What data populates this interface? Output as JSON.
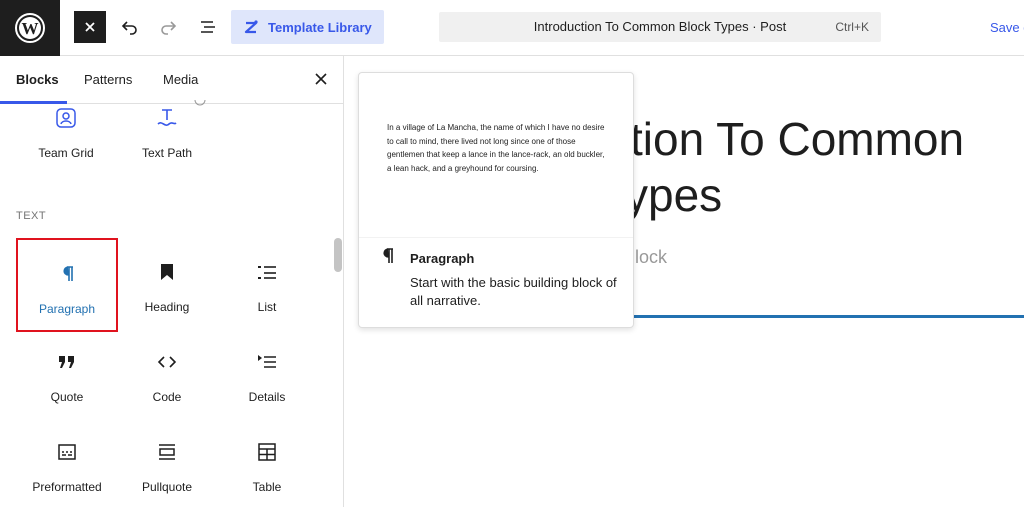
{
  "toolbar": {
    "template_library_label": "Template Library",
    "document_title": "Introduction To Common Block Types · Post",
    "shortcut": "Ctrl+K",
    "save_label": "Save d"
  },
  "sidebar": {
    "tabs": [
      {
        "label": "Blocks",
        "active": true
      },
      {
        "label": "Patterns",
        "active": false
      },
      {
        "label": "Media",
        "active": false
      }
    ],
    "prev_blocks": [
      {
        "label": "Team Grid",
        "icon": "team-grid-icon"
      },
      {
        "label": "Text Path",
        "icon": "text-path-icon"
      }
    ],
    "section_label": "TEXT",
    "text_blocks": [
      {
        "label": "Paragraph",
        "icon": "paragraph-icon",
        "selected": true
      },
      {
        "label": "Heading",
        "icon": "bookmark-icon"
      },
      {
        "label": "List",
        "icon": "list-icon"
      },
      {
        "label": "Quote",
        "icon": "quote-icon"
      },
      {
        "label": "Code",
        "icon": "code-icon"
      },
      {
        "label": "Details",
        "icon": "details-icon"
      },
      {
        "label": "Preformatted",
        "icon": "preformatted-icon"
      },
      {
        "label": "Pullquote",
        "icon": "pullquote-icon"
      },
      {
        "label": "Table",
        "icon": "table-icon"
      }
    ]
  },
  "canvas": {
    "title_line1": "ction To Common",
    "title_line2": "ypes",
    "subtitle_fragment": "lock"
  },
  "preview": {
    "sample_text": "In a village of La Mancha, the name of which I have no desire to call to mind, there lived not long since one of those gentlemen that keep a lance in the lance-rack, an old buckler, a lean hack, and a greyhound for coursing.",
    "block_title": "Paragraph",
    "block_description": "Start with the basic building block of all narrative."
  },
  "colors": {
    "accent": "#3858e9",
    "selected_border": "#e0131e",
    "selected_text": "#2271b1",
    "dark": "#1e1e1e"
  }
}
